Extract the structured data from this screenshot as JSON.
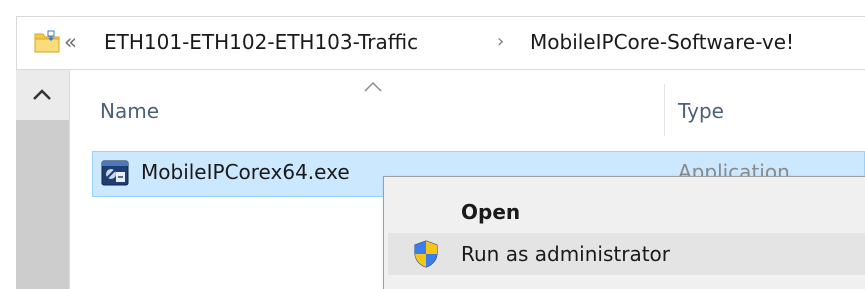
{
  "address_bar": {
    "overflow_glyph": "«",
    "breadcrumbs": [
      "ETH101-ETH102-ETH103-Traffic",
      "MobileIPCore-Software-ve!"
    ],
    "separator": "›",
    "folder_icon": "folder-icon"
  },
  "columns": {
    "name": "Name",
    "type": "Type",
    "sort_indicator": "chevron-up-icon",
    "sort_direction": "ascending"
  },
  "files": [
    {
      "name": "MobileIPCorex64.exe",
      "type": "Application",
      "icon": "application-exe-icon",
      "selected": true
    }
  ],
  "context_menu": {
    "items": [
      {
        "label": "Open",
        "bold": true,
        "icon": ""
      },
      {
        "label": "Run as administrator",
        "bold": false,
        "icon": "uac-shield-icon",
        "highlighted": true
      }
    ]
  },
  "colors": {
    "selection_background": "#cce8ff",
    "selection_border": "#99d1ff",
    "menu_background": "#f0f0f0",
    "menu_hover": "#e4e4e4",
    "header_text": "#4c607a",
    "folder_yellow": "#f4c84c"
  }
}
